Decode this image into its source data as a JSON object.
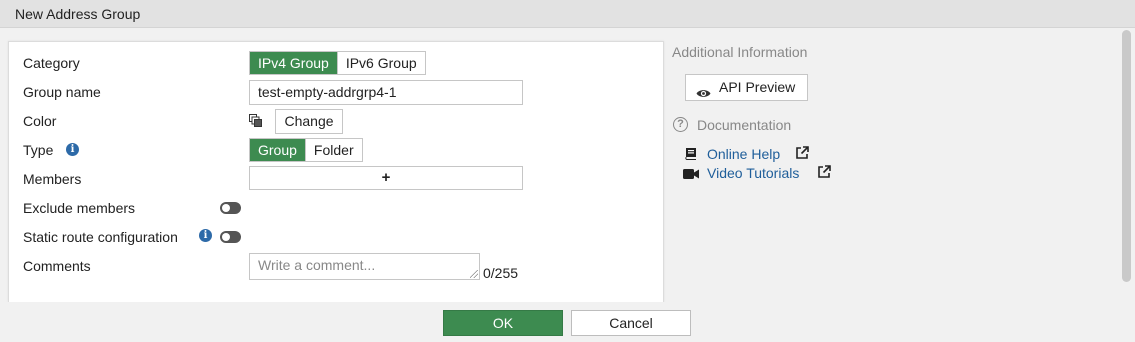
{
  "window": {
    "title": "New Address Group"
  },
  "form": {
    "category": {
      "label": "Category",
      "options": [
        "IPv4 Group",
        "IPv6 Group"
      ],
      "selected": "IPv4 Group"
    },
    "group_name": {
      "label": "Group name",
      "value": "test-empty-addrgrp4-1"
    },
    "color": {
      "label": "Color",
      "button_label": "Change",
      "icon": "color-swatch-icon"
    },
    "type": {
      "label": "Type",
      "options": [
        "Group",
        "Folder"
      ],
      "selected": "Group",
      "info_icon": "info-icon"
    },
    "members": {
      "label": "Members",
      "add_symbol": "+"
    },
    "exclude_members": {
      "label": "Exclude members",
      "enabled": false
    },
    "static_route": {
      "label": "Static route configuration",
      "enabled": false,
      "info_icon": "info-icon"
    },
    "comments": {
      "label": "Comments",
      "placeholder": "Write a comment...",
      "counter": "0/255"
    }
  },
  "sidebar": {
    "additional_info": "Additional Information",
    "api_preview": "API Preview",
    "documentation": "Documentation",
    "links": [
      {
        "label": "Online Help",
        "icon": "book-icon"
      },
      {
        "label": "Video Tutorials",
        "icon": "video-camera-icon"
      }
    ]
  },
  "footer": {
    "ok": "OK",
    "cancel": "Cancel"
  },
  "colors": {
    "accent": "#3d8b50",
    "link": "#1f5e9a",
    "info": "#2d6aa8"
  }
}
